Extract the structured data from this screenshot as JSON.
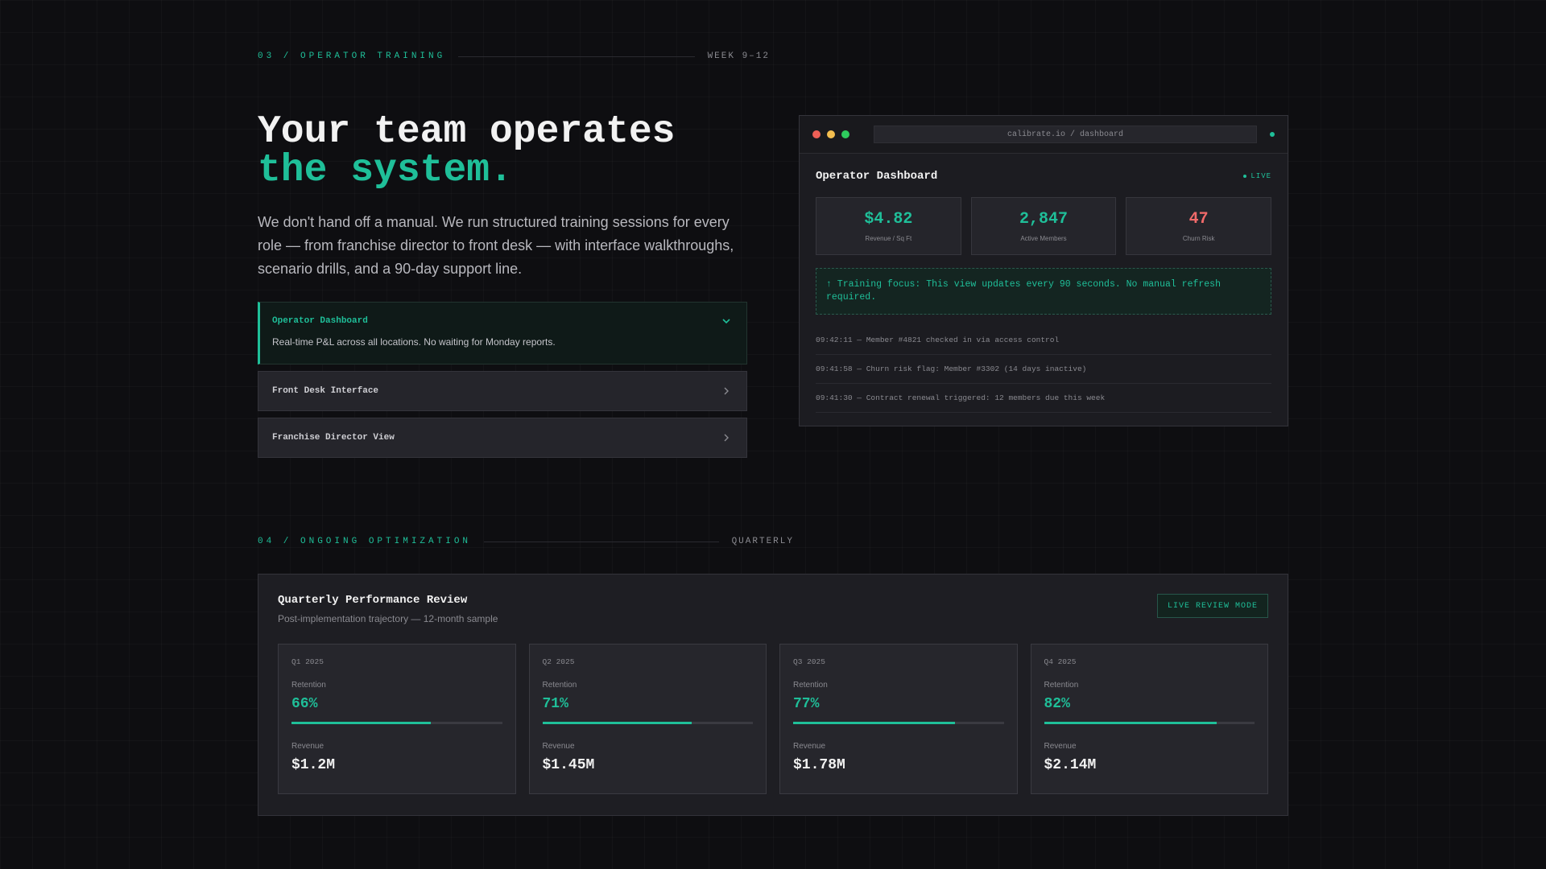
{
  "training_section": {
    "label": "03 / OPERATOR TRAINING",
    "right_label": "WEEK 9–12"
  },
  "hero": {
    "title_line1": "Your team operates",
    "title_line2": "the system.",
    "description": "We don't hand off a manual. We run structured training sessions for every role — from franchise director to front desk — with interface walkthroughs, scenario drills, and a 90-day support line."
  },
  "accordion": [
    {
      "title": "Operator Dashboard",
      "body": "Real-time P&L across all locations. No waiting for Monday reports.",
      "open": true
    },
    {
      "title": "Front Desk Interface",
      "open": false
    },
    {
      "title": "Franchise Director View",
      "open": false
    }
  ],
  "window": {
    "url": "calibrate.io / dashboard",
    "title": "Operator Dashboard",
    "live_label": "LIVE",
    "kpis": [
      {
        "value": "$4.82",
        "label": "Revenue / Sq Ft",
        "color": "#1fbf99"
      },
      {
        "value": "2,847",
        "label": "Active Members",
        "color": "#1fbf99"
      },
      {
        "value": "47",
        "label": "Churn Risk",
        "color": "#f26a6a"
      }
    ],
    "notice": "↑ Training focus: This view updates every 90 seconds. No manual refresh required.",
    "log": [
      "09:42:11 — Member #4821 checked in via access control",
      "09:41:58 — Churn risk flag: Member #3302 (14 days inactive)",
      "09:41:30 — Contract renewal triggered: 12 members due this week"
    ]
  },
  "optimization_section": {
    "label": "04 / ONGOING OPTIMIZATION",
    "right_label": "QUARTERLY"
  },
  "quarterly": {
    "title": "Quarterly Performance Review",
    "subtitle": "Post-implementation trajectory — 12-month sample",
    "button_label": "LIVE REVIEW MODE",
    "retention_label": "Retention",
    "revenue_label": "Revenue",
    "cards": [
      {
        "period": "Q1 2025",
        "retention": "66%",
        "retention_pct": 66,
        "revenue": "$1.2M"
      },
      {
        "period": "Q2 2025",
        "retention": "71%",
        "retention_pct": 71,
        "revenue": "$1.45M"
      },
      {
        "period": "Q3 2025",
        "retention": "77%",
        "retention_pct": 77,
        "revenue": "$1.78M"
      },
      {
        "period": "Q4 2025",
        "retention": "82%",
        "retention_pct": 82,
        "revenue": "$2.14M"
      }
    ]
  },
  "colors": {
    "accent": "#1fbf99",
    "danger": "#f26a6a",
    "window_dot_red": "#ed5f56",
    "window_dot_yellow": "#f4be4f",
    "window_dot_green": "#2ecb5d"
  }
}
